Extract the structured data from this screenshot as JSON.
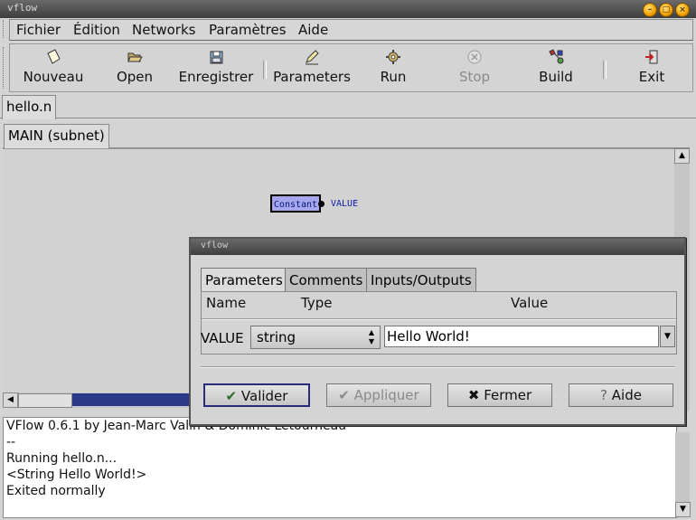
{
  "window": {
    "title": "vflow"
  },
  "menu": [
    "Fichier",
    "Édition",
    "Networks",
    "Paramètres",
    "Aide"
  ],
  "toolbar": {
    "buttons": [
      {
        "label": "Nouveau",
        "icon": "new-file-icon"
      },
      {
        "label": "Open",
        "icon": "open-folder-icon"
      },
      {
        "label": "Enregistrer",
        "icon": "save-disk-icon"
      },
      {
        "label": "Parameters",
        "icon": "parameters-pen-icon"
      },
      {
        "label": "Run",
        "icon": "run-gear-icon"
      },
      {
        "label": "Stop",
        "icon": "stop-icon",
        "disabled": true
      },
      {
        "label": "Build",
        "icon": "build-icon"
      },
      {
        "label": "Exit",
        "icon": "exit-icon"
      }
    ]
  },
  "doc_tab": "hello.n",
  "subnet_tab": "MAIN (subnet)",
  "node": {
    "label": "Constant",
    "output": "VALUE",
    "color": "#a6a6ee"
  },
  "console": {
    "lines": [
      "VFlow 0.6.1 by Jean-Marc Valin & Dominic Letourneau",
      "--",
      "Running hello.n...",
      "<String Hello World!>",
      "Exited normally"
    ]
  },
  "dialog": {
    "title": "vflow",
    "tabs": [
      "Parameters",
      "Comments",
      "Inputs/Outputs"
    ],
    "headers": {
      "name": "Name",
      "type": "Type",
      "value": "Value"
    },
    "row": {
      "name": "VALUE",
      "type": "string",
      "value": "Hello World!"
    },
    "buttons": {
      "ok": "Valider",
      "apply": "Appliquer",
      "close": "Fermer",
      "help": "Aide"
    }
  }
}
